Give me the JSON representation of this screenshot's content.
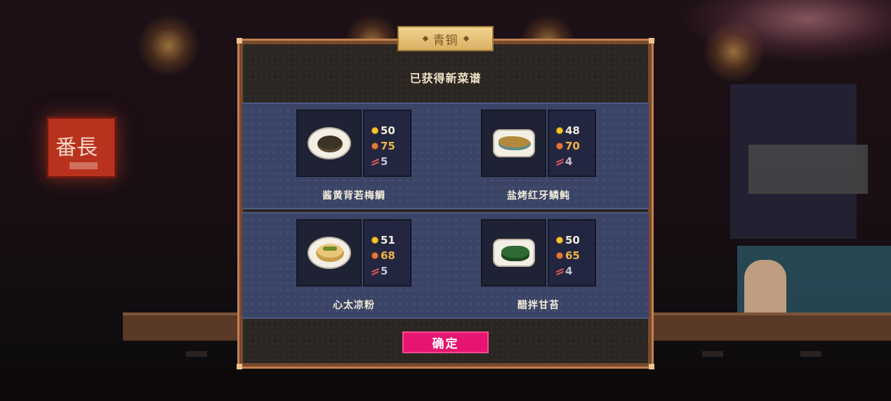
{
  "dialog": {
    "tier_label": "青铜",
    "title": "已获得新菜谱",
    "confirm_label": "确定"
  },
  "recipes": [
    {
      "name": "酱黄背若梅鲷",
      "coin": "50",
      "tip": "75",
      "chop": "5",
      "dish_icon": "braised-fish-dish-icon"
    },
    {
      "name": "盐烤红牙鳞鲀",
      "coin": "48",
      "tip": "70",
      "chop": "4",
      "dish_icon": "grilled-fish-dish-icon"
    },
    {
      "name": "心太凉粉",
      "coin": "51",
      "tip": "68",
      "chop": "5",
      "dish_icon": "jelly-noodle-dish-icon"
    },
    {
      "name": "醋拌甘苔",
      "coin": "50",
      "tip": "65",
      "chop": "4",
      "dish_icon": "seaweed-salad-dish-icon"
    }
  ],
  "stat_icons": {
    "coin": "gold-coin-icon",
    "tip": "tip-icon",
    "chop": "chopsticks-icon"
  },
  "colors": {
    "confirm_button": "#e6156f",
    "tier_tag": "#e6c47c",
    "panel_band": "#3a4466",
    "tip_value": "#f0b248"
  }
}
